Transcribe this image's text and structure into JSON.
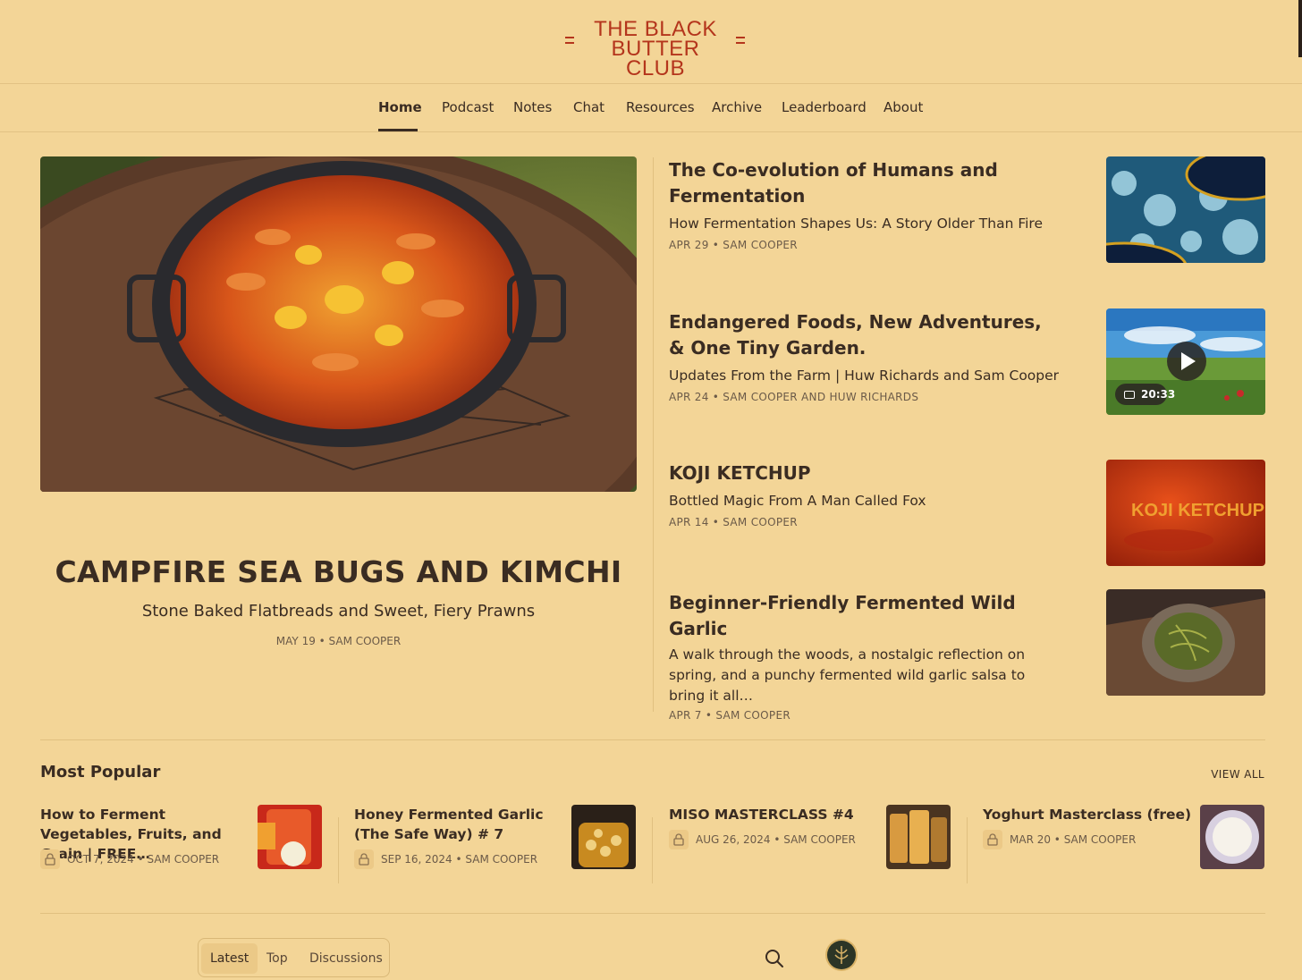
{
  "brand": {
    "line1": "THE BLACK",
    "line2": "BUTTER CLUB",
    "color": "#b4351c"
  },
  "nav": {
    "items": [
      "Home",
      "Podcast",
      "Notes",
      "Chat",
      "Resources",
      "Archive",
      "Leaderboard",
      "About"
    ],
    "active": "Home"
  },
  "hero": {
    "title": "CAMPFIRE SEA BUGS AND KIMCHI",
    "subtitle": "Stone Baked Flatbreads and Sweet, Fiery Prawns",
    "meta": "MAY 19 • SAM COOPER",
    "image": "paella-pan-with-prawns-on-fire-pit"
  },
  "posts": [
    {
      "title": "The Co-evolution of Humans and Fermentation",
      "subtitle": "How Fermentation Shapes Us: A Story Older Than Fire",
      "meta": "APR 29 • SAM COOPER",
      "image": "microscope-fermentation-culture"
    },
    {
      "title": "Endangered Foods, New Adventures, & One Tiny Garden.",
      "subtitle": "Updates From the Farm | Huw Richards and Sam Cooper",
      "meta": "APR 24 • SAM COOPER AND HUW RICHARDS",
      "image": "garden-field-video",
      "video_duration": "20:33"
    },
    {
      "title": "KOJI KETCHUP",
      "subtitle": "Bottled Magic From A Man Called Fox",
      "meta": "APR 14 • SAM COOPER",
      "image": "koji-ketchup-red-sauce",
      "image_text": "KOJI KETCHUP"
    },
    {
      "title": "Beginner-Friendly Fermented Wild Garlic",
      "subtitle": "A walk through the woods, a nostalgic reflection on spring, and a punchy fermented wild garlic salsa to bring it all…",
      "meta": "APR 7 • SAM COOPER",
      "image": "wild-garlic-bowl-on-wood"
    }
  ],
  "most_popular": {
    "title": "Most Popular",
    "view_all": "VIEW ALL",
    "items": [
      {
        "title": "How to Ferment Vegetables, Fruits, and Grain | FREE…",
        "meta": "OCT 7, 2024 • SAM COOPER",
        "locked": true,
        "image": "fermented-vegetables-jar"
      },
      {
        "title": "Honey Fermented Garlic (The Safe Way) # 7",
        "meta": "SEP 16, 2024 • SAM COOPER",
        "locked": true,
        "image": "honey-garlic-jar"
      },
      {
        "title": "MISO MASTERCLASS #4",
        "meta": "AUG 26, 2024 • SAM COOPER",
        "locked": true,
        "image": "miso-jars"
      },
      {
        "title": "Yoghurt Masterclass (free)",
        "meta": "MAR 20 • SAM COOPER",
        "locked": true,
        "image": "yoghurt-bowl"
      }
    ]
  },
  "tabs": {
    "items": [
      "Latest",
      "Top",
      "Discussions"
    ],
    "active": "Latest"
  },
  "icons": {
    "search": "search-icon",
    "avatar": "publication-avatar"
  },
  "colors": {
    "background": "#f3d597",
    "text": "#3a2c22",
    "meta": "#6b5a48",
    "accent": "#b4351c"
  }
}
